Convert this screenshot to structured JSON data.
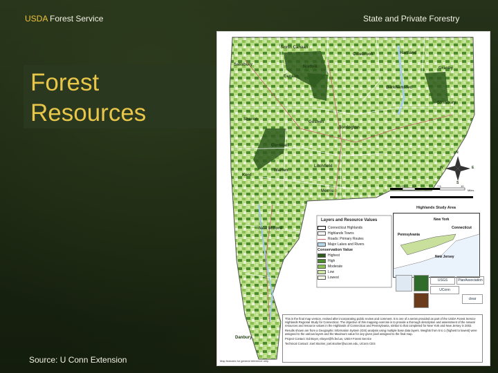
{
  "header": {
    "agency_prefix": "USDA",
    "agency_rest": " Forest Service",
    "program": "State and Private Forestry"
  },
  "slide": {
    "title_line1": "Forest",
    "title_line2": "Resources",
    "source": "Source: U Conn Extension"
  },
  "map": {
    "towns": [
      "North Canaan",
      "Colebrook",
      "Hartland",
      "Salisbury",
      "Norfolk",
      "Granby",
      "Canaan",
      "Barkhamsted",
      "Simsbury",
      "Sharon",
      "Goshen",
      "Torrington",
      "Cornwall",
      "Warren",
      "Litchfield",
      "Kent",
      "Morris",
      "New Milford",
      "Danbury",
      "Canton",
      "Winchester",
      "Harwinton",
      "Burlington",
      "Sherman",
      "New Fairfield",
      "Brookfield",
      "Newtown"
    ],
    "compass": {
      "n": "N",
      "s": "S",
      "e": "E",
      "w": "W"
    },
    "scale_ticks": [
      "0",
      "1.25",
      "2.5",
      "5",
      "7.5",
      "10"
    ],
    "scale_unit": "Miles",
    "legend": {
      "title": "Layers and Resource Values",
      "layers": [
        {
          "label": "Connecticut Highlands",
          "color": "#ffffff"
        },
        {
          "label": "Highlands Towns",
          "color": "#f4f4f4"
        },
        {
          "label": "Roads: Primary Routes",
          "color": "#c06060"
        },
        {
          "label": "Major Lakes and Rivers",
          "color": "#b8d8ee"
        }
      ],
      "conservation_title": "Conservation Value",
      "values": [
        {
          "label": "Highest",
          "color": "#2f5a1e"
        },
        {
          "label": "High",
          "color": "#4e8a2e"
        },
        {
          "label": "Moderate",
          "color": "#8cc055"
        },
        {
          "label": "Low",
          "color": "#cfe6a6"
        },
        {
          "label": "Lowest",
          "color": "#f3f8e8"
        }
      ]
    },
    "inset": {
      "title": "Highlands Study Area",
      "labels": [
        "New York",
        "Connecticut",
        "Pennsylvania",
        "New Jersey"
      ]
    },
    "logos": [
      "USGS",
      "PlanAssociation",
      "clear",
      "UConn"
    ],
    "notes": [
      "This is the final map version, revised after incorporating public review and comment. It is one of a series provided as part of the USDA Forest Service Highlands Regional Study for Connecticut. The objective of this mapping exercise is to provide a thorough description and assessment of the natural resources and resource values in the Highlands of Connecticut and Pennsylvania, similar to that completed for New York and New Jersey in 2002.",
      "Results shown are from a Geographic Information System (GIS) analysis using multiple base data layers. Weights from 5 to 1 (highest to lowest) were assigned to the various layers and the Maximum value for any given pixel assigned to the final map.",
      "Project Contact: Ed Boyer, eboyer@fs.fed.us, USDA Forest Service",
      "Technical Contact: Joel Stocker, joel.stocker@uconn.edu, UConn CES"
    ],
    "footer_note": "Map features for general reference only"
  },
  "colors": {
    "accent_title": "#e8c64a",
    "usda": "#f0c43c",
    "background": "#1b2611"
  }
}
